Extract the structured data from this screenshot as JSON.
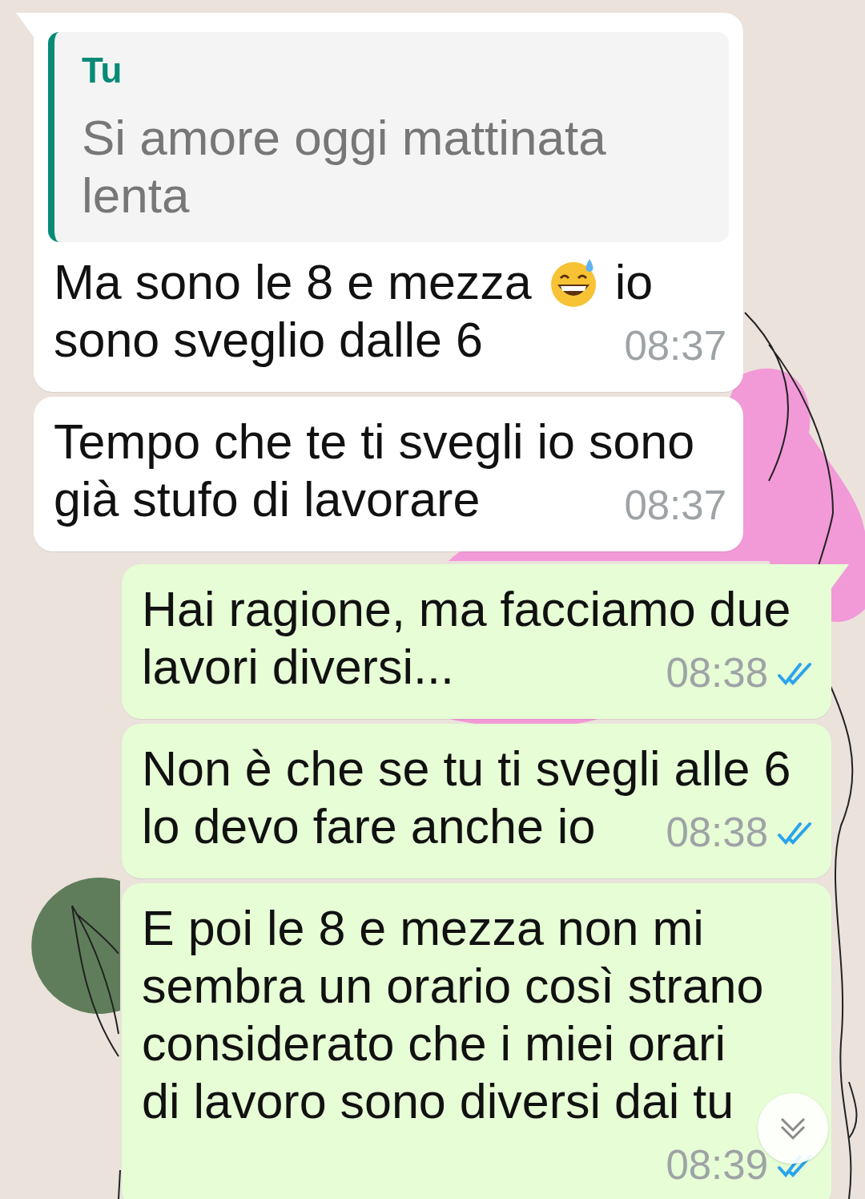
{
  "messages": [
    {
      "outgoing": false,
      "tail": true,
      "quote": {
        "author": "Tu",
        "text": "Si amore oggi mattinata\nlenta"
      },
      "lines": [
        [
          {
            "kind": "text",
            "text": "Ma sono le 8 e mezza"
          },
          {
            "kind": "emoji"
          },
          {
            "kind": "text",
            "text": "io"
          }
        ],
        [
          {
            "kind": "text",
            "text": "sono sveglio dalle 6"
          }
        ]
      ],
      "time": "08:37"
    },
    {
      "outgoing": false,
      "tail": false,
      "lines": [
        [
          {
            "kind": "text",
            "text": "Tempo che te ti svegli io sono"
          }
        ],
        [
          {
            "kind": "text",
            "text": "già stufo di lavorare"
          }
        ]
      ],
      "time": "08:37"
    },
    {
      "outgoing": true,
      "tail": true,
      "lines": [
        [
          {
            "kind": "text",
            "text": "Hai ragione, ma facciamo due"
          }
        ],
        [
          {
            "kind": "text",
            "text": "lavori diversi..."
          }
        ]
      ],
      "time": "08:38",
      "read": true
    },
    {
      "outgoing": true,
      "tail": false,
      "lines": [
        [
          {
            "kind": "text",
            "text": "Non è che se tu ti svegli alle 6"
          }
        ],
        [
          {
            "kind": "text",
            "text": "lo devo fare anche io"
          }
        ]
      ],
      "time": "08:38",
      "read": true
    },
    {
      "outgoing": true,
      "tail": false,
      "lines": [
        [
          {
            "kind": "text",
            "text": "E poi le 8 e mezza non mi"
          }
        ],
        [
          {
            "kind": "text",
            "text": "sembra un orario così strano"
          }
        ],
        [
          {
            "kind": "text",
            "text": "considerato che i miei orari"
          }
        ],
        [
          {
            "kind": "text",
            "text": "di lavoro sono diversi dai tu"
          }
        ]
      ],
      "time": "08:39",
      "read": true
    }
  ]
}
